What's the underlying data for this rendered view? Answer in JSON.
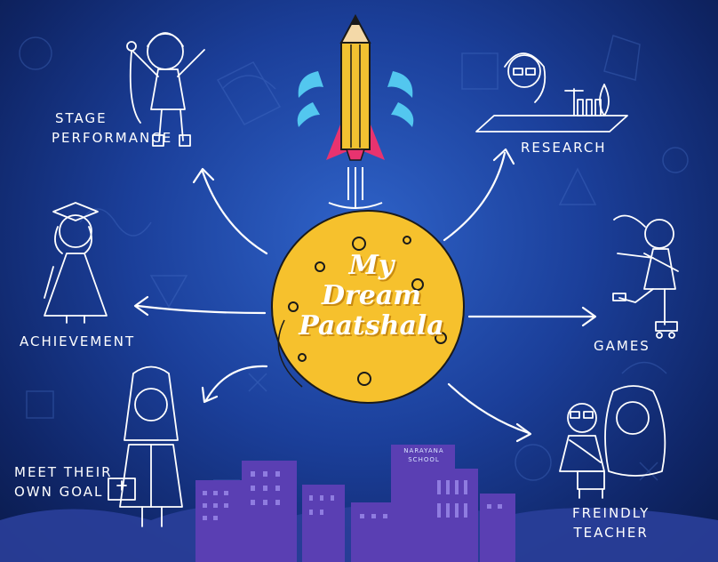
{
  "center": {
    "line1": "My",
    "line2": "Dream",
    "line3": "Paatshala"
  },
  "labels": {
    "stage_line1": "Stage",
    "stage_line2": "Performance",
    "research": "Research",
    "achievement": "Achievement",
    "games": "Games",
    "goal_line1": "Meet their",
    "goal_line2": "own goal",
    "teacher_line1": "Freindly",
    "teacher_line2": "Teacher"
  },
  "building_sign": {
    "line1": "NARAYANA",
    "line2": "SCHOOL"
  },
  "colors": {
    "background": "#1b3f9a",
    "moon": "#f6c12d",
    "pencil": "#f2c231",
    "rocket_fin": "#e8336f",
    "splash": "#53c7ef",
    "buildings": "#5a3fb3"
  }
}
